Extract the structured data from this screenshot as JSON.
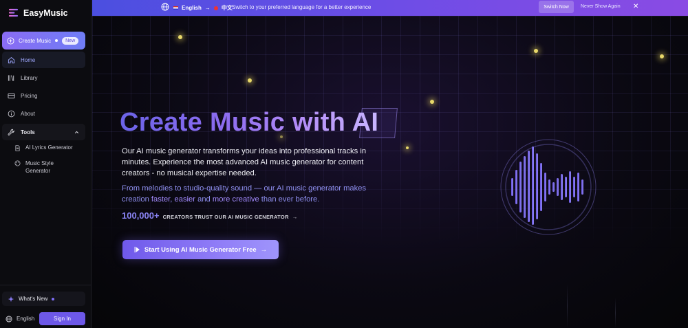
{
  "app": {
    "name": "EasyMusic"
  },
  "sidebar": {
    "create": {
      "label": "Create Music",
      "badge": "New"
    },
    "nav": [
      {
        "label": "Home"
      },
      {
        "label": "Library"
      },
      {
        "label": "Pricing"
      },
      {
        "label": "About"
      }
    ],
    "tools": {
      "label": "Tools",
      "items": [
        {
          "label": "AI Lyrics Generator"
        },
        {
          "label": "Music Style Generator"
        }
      ]
    },
    "whats_new": "What's New",
    "language": "English",
    "sign_in": "Sign In"
  },
  "banner": {
    "lang_from": "English",
    "lang_to": "中文",
    "arrow": "→",
    "message": "Switch to your preferred language for a better experience",
    "switch_now": "Switch Now",
    "never_show": "Never Show Again",
    "close": "✕"
  },
  "hero": {
    "title": "Create Music with AI",
    "description": "Our AI music generator transforms your ideas into professional tracks in minutes. Experience the most advanced AI music generator for content creators - no musical expertise needed.",
    "sub_prefix": "From melodies to studio-quality sound — our AI music generator makes creation ",
    "sub_hl1": "faster",
    "sub_sep1": ", ",
    "sub_hl2": "easier",
    "sub_sep2": " and ",
    "sub_hl3": "more creative",
    "sub_suffix": " than ever before.",
    "stats_number": "100,000+",
    "stats_text": "CREATORS TRUST OUR AI MUSIC GENERATOR",
    "stats_arrow": "→",
    "cta_label": "Start Using AI Music Generator Free",
    "cta_arrow": "→"
  },
  "colors": {
    "accent": "#6d58e8",
    "banner_start": "#4b4fe0",
    "banner_end": "#8a4be4",
    "spark": "#e8d86a"
  },
  "icons": [
    "brand-logo-icon",
    "plus-circle-icon",
    "home-icon",
    "library-icon",
    "pricing-icon",
    "info-icon",
    "wrench-icon",
    "chevron-up-icon",
    "document-icon",
    "palette-icon",
    "sparkle-icon",
    "globe-icon",
    "play-icon",
    "arrow-right-icon",
    "close-icon",
    "waveform-icon"
  ]
}
